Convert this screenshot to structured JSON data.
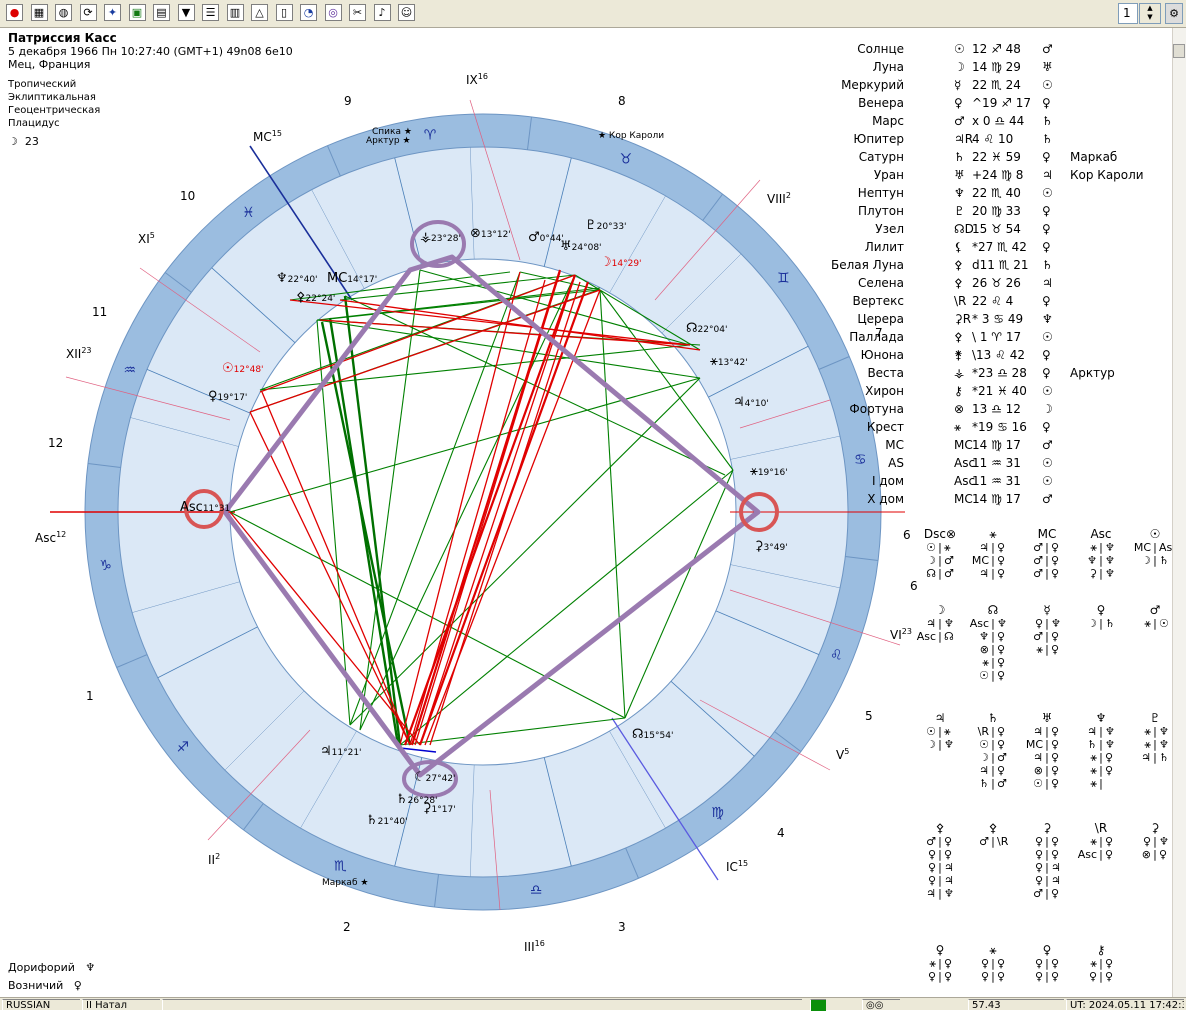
{
  "toolbar": {
    "icons": [
      "stop-icon",
      "grid-icon",
      "globe-icon",
      "cycle-icon",
      "sky-icon",
      "map-icon",
      "print-icon",
      "filter-icon",
      "list-icon",
      "table-icon",
      "aspect-icon",
      "doc-icon",
      "chart-icon",
      "circle-icon",
      "tools-icon",
      "bell-icon",
      "person-icon"
    ],
    "zoom_value": "1"
  },
  "header": {
    "name": "Патриссия Касс",
    "datetime": "5 декабря 1966  Пн   10:27:40 (GMT+1)  49n08  6e10",
    "place": "Мец, Франция",
    "zodiac": "Тропический",
    "coords": "Эклиптикальная",
    "center": "Геоцентрическая",
    "houses": "Плацидус",
    "moon_glyph": "☽",
    "moon_val": "23"
  },
  "wheel": {
    "sign_glyphs": [
      "♑",
      "♐",
      "♏",
      "♎",
      "♍",
      "♌",
      "♋",
      "♊",
      "♉",
      "♈",
      "♓",
      "♒"
    ],
    "house_numbers": [
      "10",
      "11",
      "12",
      "1",
      "2",
      "3",
      "4",
      "5",
      "6",
      "7",
      "8",
      "9"
    ],
    "cusp_labels": {
      "mc": "MC",
      "mc_sup": "15",
      "ic": "IC",
      "ic_sup": "15",
      "asc": "Asc",
      "asc_sup": "12",
      "ix": "IX",
      "ix_sup": "16",
      "iii": "III",
      "iii_sup": "16",
      "viii": "VIII",
      "viii_sup": "2",
      "ii": "II",
      "ii_sup": "2",
      "xi": "XI",
      "xi_sup": "5",
      "v": "V",
      "v_sup": "5",
      "xii": "XII",
      "xii_sup": "23",
      "vi": "VI",
      "vi_sup": "23"
    },
    "stars": [
      {
        "label": "Спика",
        "g": "★"
      },
      {
        "label": "Арктур",
        "g": "★"
      },
      {
        "label": "★ Кор Кароли",
        "g": ""
      },
      {
        "label": "Маркаб ★",
        "g": ""
      }
    ],
    "planet_labels": [
      {
        "g": "⚶",
        "t": "23°28'"
      },
      {
        "g": "⊗",
        "t": "13°12'"
      },
      {
        "g": "♂",
        "t": "0°44'"
      },
      {
        "g": "♅",
        "t": "24°08'"
      },
      {
        "g": "♇",
        "t": "20°33'"
      },
      {
        "g": "☽",
        "t": "14°29'"
      },
      {
        "g": "♆",
        "t": "22°40'"
      },
      {
        "g": "MC",
        "t": "14°17'"
      },
      {
        "g": "⚴",
        "t": "22°24'"
      },
      {
        "g": "☊",
        "t": "22°04'"
      },
      {
        "g": "⚹",
        "t": "13°42'"
      },
      {
        "g": "♃",
        "t": "4°10'"
      },
      {
        "g": "☉",
        "t": "12°48'"
      },
      {
        "g": "♀",
        "t": "19°17'"
      },
      {
        "g": "Asc",
        "t": "11°31"
      },
      {
        "g": "⚹",
        "t": "19°16'"
      },
      {
        "g": "⚳",
        "t": "3°49'"
      },
      {
        "g": "♃",
        "t": "11°21'"
      },
      {
        "g": "☾",
        "t": "27°42'"
      },
      {
        "g": "♄",
        "t": "26°28'"
      },
      {
        "g": "⚳",
        "t": "1°17'"
      },
      {
        "g": "♄",
        "t": "21°40'"
      },
      {
        "g": "☊",
        "t": "15°54'"
      }
    ]
  },
  "planets": [
    {
      "name": "Солнце",
      "g": "☉",
      "pos": "12 ♐ 48",
      "r": "♂",
      "extra": ""
    },
    {
      "name": "Луна",
      "g": "☽",
      "pos": "14 ♍ 29",
      "r": "♅",
      "extra": ""
    },
    {
      "name": "Меркурий",
      "g": "☿",
      "pos": "22 ♏ 24",
      "r": "☉",
      "extra": ""
    },
    {
      "name": "Венера",
      "g": "♀",
      "pos": "^19 ♐ 17",
      "r": "♀",
      "extra": ""
    },
    {
      "name": "Марс",
      "g": "♂",
      "pos": "x 0 ♎ 44",
      "r": "♄",
      "extra": ""
    },
    {
      "name": "Юпитер",
      "g": "♃R",
      "pos": "4 ♌ 10",
      "r": "♄",
      "extra": ""
    },
    {
      "name": "Сатурн",
      "g": "♄",
      "pos": "22 ♓ 59",
      "r": "♀",
      "extra": "Маркаб"
    },
    {
      "name": "Уран",
      "g": "♅",
      "pos": "+24 ♍ 8",
      "r": "♃",
      "extra": "Кор Кароли"
    },
    {
      "name": "Нептун",
      "g": "♆",
      "pos": "22 ♏ 40",
      "r": "☉",
      "extra": ""
    },
    {
      "name": "Плутон",
      "g": "♇",
      "pos": "20 ♍ 33",
      "r": "♀",
      "extra": ""
    },
    {
      "name": "Узел",
      "g": "☊D",
      "pos": "15 ♉ 54",
      "r": "♀",
      "extra": ""
    },
    {
      "name": "Лилит",
      "g": "⚸",
      "pos": "*27 ♏ 42",
      "r": "♀",
      "extra": ""
    },
    {
      "name": "Белая Луна",
      "g": "⚴",
      "pos": "d11 ♏ 21",
      "r": "♄",
      "extra": ""
    },
    {
      "name": "Селена",
      "g": "⚴",
      "pos": "26 ♉ 26",
      "r": "♃",
      "extra": ""
    },
    {
      "name": "Вертекс",
      "g": "\\R",
      "pos": "22 ♌ 4",
      "r": "♀",
      "extra": ""
    },
    {
      "name": "Церера",
      "g": "⚳R",
      "pos": "* 3 ♋ 49",
      "r": "♆",
      "extra": ""
    },
    {
      "name": "Паллада",
      "g": "⚴",
      "pos": "\\ 1 ♈ 17",
      "r": "☉",
      "extra": ""
    },
    {
      "name": "Юнона",
      "g": "⚵",
      "pos": "\\13 ♌ 42",
      "r": "♀",
      "extra": ""
    },
    {
      "name": "Веста",
      "g": "⚶",
      "pos": "*23 ♎ 28",
      "r": "♀",
      "extra": "Арктур"
    },
    {
      "name": "Хирон",
      "g": "⚷",
      "pos": "*21 ♓ 40",
      "r": "☉",
      "extra": ""
    },
    {
      "name": "Фортуна",
      "g": "⊗",
      "pos": "13 ♎ 12",
      "r": "☽",
      "extra": ""
    },
    {
      "name": "Крест",
      "g": "⚹",
      "pos": "*19 ♋ 16",
      "r": "♀",
      "extra": ""
    },
    {
      "name": "MC",
      "g": "MC",
      "pos": "14 ♍ 17",
      "r": "♂",
      "extra": ""
    },
    {
      "name": "AS",
      "g": "Asc",
      "pos": "11 ♒ 31",
      "r": "☉",
      "extra": ""
    },
    {
      "name": "I дом",
      "g": "Asc",
      "pos": "11 ♒ 31",
      "r": "☉",
      "extra": ""
    },
    {
      "name": "X дом",
      "g": "MC",
      "pos": "14 ♍ 17",
      "r": "♂",
      "extra": ""
    }
  ],
  "dispositors": [
    {
      "h": "Dsc⊗",
      "rows": [
        "☉|⚹",
        "☽|♂",
        "☊|♂"
      ]
    },
    {
      "h": "⚹",
      "rows": [
        "♃|♀",
        "MC|♀",
        "♃|♀"
      ]
    },
    {
      "h": "MC",
      "rows": [
        "♂|♀",
        "♂|♀",
        "♂|♀"
      ]
    },
    {
      "h": "Asc",
      "rows": [
        "⚹|♆",
        "♆|♆",
        "⚳|♆"
      ]
    },
    {
      "h": "☉",
      "rows": [
        "MC|Asc",
        "☽|♄",
        ""
      ]
    },
    {
      "h": "☽",
      "rows": [
        "♃|♆",
        "Asc|☊",
        ""
      ]
    },
    {
      "h": "☊",
      "rows": [
        "Asc|♆",
        "♆|♀",
        "⊗|♀",
        "⚹|♀",
        "☉|♀"
      ]
    },
    {
      "h": "☿",
      "rows": [
        "♀|♆",
        "♂|♀",
        "⚹|♀"
      ]
    },
    {
      "h": "♀",
      "rows": [
        "☽|♄",
        ""
      ]
    },
    {
      "h": "♂",
      "rows": [
        "⚹|☉",
        ""
      ]
    },
    {
      "h": "♃",
      "rows": [
        "☉|⚹",
        "☽|♆",
        ""
      ]
    },
    {
      "h": "♄",
      "rows": [
        "\\R|♀",
        "☉|♀",
        "☽|♂",
        "♃|♀",
        "♄|♂"
      ]
    },
    {
      "h": "♅",
      "rows": [
        "♃|♀",
        "MC|♀",
        "♃|♀",
        "⊗|♀",
        "☉|♀"
      ]
    },
    {
      "h": "♆",
      "rows": [
        "♃|♆",
        "♄|♆",
        "⚹|♀",
        "⚹|♀",
        "⚹|"
      ]
    },
    {
      "h": "♇",
      "rows": [
        "⚹|♆",
        "⚹|♆",
        "♃|♄",
        ""
      ]
    },
    {
      "h": "⚴",
      "rows": [
        "♂|♀",
        "♀|♀",
        "♀|♃",
        "♀|♃",
        "♃|♆"
      ]
    },
    {
      "h": "⚴",
      "rows": [
        "♂|\\R",
        ""
      ]
    },
    {
      "h": "⚳",
      "rows": [
        "♀|♀",
        "♀|♀",
        "♀|♃",
        "♀|♃",
        "♂|♀"
      ]
    },
    {
      "h": "\\R",
      "rows": [
        "⚹|♀",
        "Asc|♀"
      ]
    },
    {
      "h": "⚳",
      "rows": [
        "♀|♆",
        "⊗|♀"
      ]
    },
    {
      "h": "♀",
      "rows": [
        "⚹|♀",
        "♀|♀"
      ]
    },
    {
      "h": "⚹",
      "rows": [
        "♀|♀",
        "♀|♀"
      ]
    },
    {
      "h": "♀",
      "rows": [
        "♀|♀",
        "♀|♀"
      ]
    },
    {
      "h": "⚷",
      "rows": [
        "⚹|♀",
        "♀|♀"
      ]
    }
  ],
  "left_labels": {
    "a1": "6",
    "a2": "VI",
    "a2_sup": "23",
    "b": "5",
    "c": "4",
    "d": "V",
    "d_sup": "5",
    "e": "IC",
    "e_sup": "15"
  },
  "footer": {
    "doriphory": "Дорифорий",
    "doriphory_g": "♆",
    "voznichiy": "Возничий",
    "voznichiy_g": "♀"
  },
  "status": {
    "lang": "RUSSIAN",
    "mode": "II Натал",
    "value": "57.43",
    "time": "UT: 2024.05.11 17:42:39"
  },
  "colors": {
    "ring": "#9bbde0",
    "inner": "#dbe8f6",
    "red": "#e00000",
    "green": "#008000",
    "purple": "#9a7ab0"
  }
}
